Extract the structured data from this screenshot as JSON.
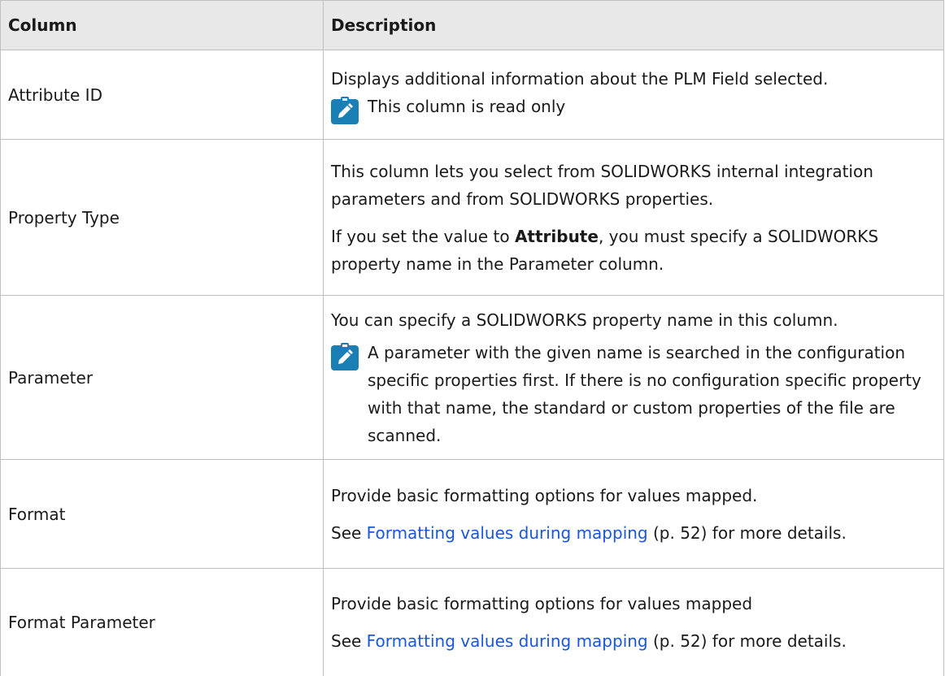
{
  "header": {
    "col1": "Column",
    "col2": "Description"
  },
  "rows": [
    {
      "name": "Attribute ID",
      "para1": "Displays additional information about the PLM Field selected.",
      "note": "This column is read only"
    },
    {
      "name": "Property Type",
      "para1": "This column lets you select from SOLIDWORKS internal integration parameters and from SOLIDWORKS properties.",
      "para2_prefix": "If you set the value to ",
      "para2_bold": "Attribute",
      "para2_suffix": ", you must specify a SOLIDWORKS property name in the Parameter column."
    },
    {
      "name": "Parameter",
      "para1": "You can specify a SOLIDWORKS property name in this column.",
      "note": "A parameter with the given name is searched in the configuration specific properties first. If there is no configuration specific property with that name, the standard or custom properties of the file are scanned."
    },
    {
      "name": "Format",
      "para1": "Provide basic formatting options for values mapped.",
      "para2_prefix": "See ",
      "para2_link": "Formatting values during mapping",
      "para2_suffix": " (p. 52) for more details."
    },
    {
      "name": "Format Parameter",
      "para1": "Provide basic formatting options for values mapped",
      "para2_prefix": "See ",
      "para2_link": "Formatting values during mapping",
      "para2_suffix": " (p. 52) for more details."
    }
  ],
  "icons": {
    "note": "note-pencil-icon"
  },
  "colors": {
    "header_bg": "#e8e8e8",
    "note_icon": "#1a7fb5",
    "link": "#1a56db",
    "border": "#bfbfbf"
  }
}
